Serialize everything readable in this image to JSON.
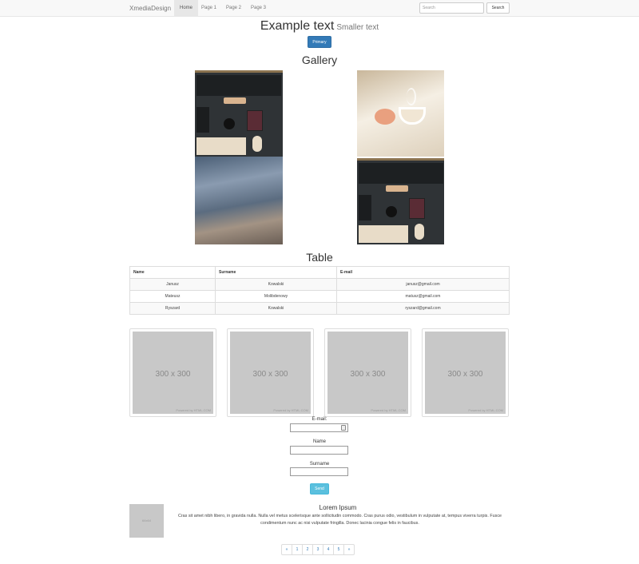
{
  "navbar": {
    "brand": "XmediaDesign",
    "items": [
      {
        "label": "Home",
        "active": true
      },
      {
        "label": "Page 1",
        "active": false
      },
      {
        "label": "Page 2",
        "active": false
      },
      {
        "label": "Page 3",
        "active": false
      }
    ],
    "search_placeholder": "Search",
    "search_button": "Search"
  },
  "hero": {
    "title": "Example text",
    "subtitle": "Smaller text",
    "button": "Primary"
  },
  "gallery": {
    "title": "Gallery"
  },
  "table": {
    "title": "Table",
    "headers": [
      "Name",
      "Surname",
      "E-mail"
    ],
    "rows": [
      [
        "Janusz",
        "Kowalski",
        "janusz@gmail.com"
      ],
      [
        "Mateusz",
        "Molibdenowy",
        "matusz@gmail.com"
      ],
      [
        "Ryszard",
        "Kowalski",
        "ryszard@gmail.com"
      ]
    ]
  },
  "thumbnails": {
    "size_label": "300 x 300",
    "credit": "Powered by HTML.COM"
  },
  "form": {
    "email_label": "E-mail:",
    "name_label": "Name",
    "surname_label": "Surname",
    "send_button": "Send"
  },
  "media": {
    "image_label": "64x64",
    "title": "Lorem Ipsum",
    "text": "Cras sit amet nibh libero, in gravida nulla. Nulla vel metus scelerisque ante sollicitudin commodo. Cras purus odio, vestibulum in vulputate at, tempus viverra turpis. Fusce condimentum nunc ac nisi vulputate fringilla. Donec lacinia congue felis in faucibus."
  },
  "pagination": {
    "prev": "«",
    "pages": [
      "1",
      "2",
      "3",
      "4",
      "5"
    ],
    "next": "»"
  }
}
